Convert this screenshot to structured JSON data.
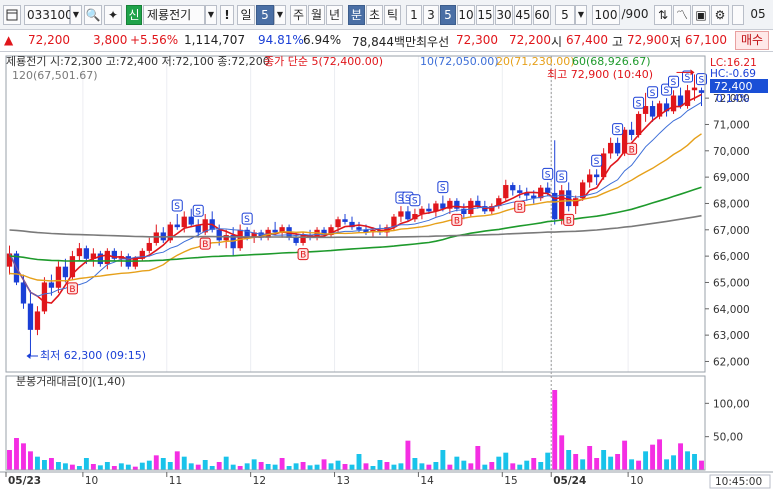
{
  "toolbar": {
    "code": "033100",
    "badge": "신",
    "name": "제룡전기",
    "mark": "!",
    "period_kind": "일",
    "period_value": "5",
    "tabs": [
      "주",
      "월",
      "년",
      "분",
      "초",
      "틱"
    ],
    "minutes": [
      "1",
      "3",
      "5",
      "10",
      "15",
      "30",
      "45",
      "60"
    ],
    "interval": "5",
    "count": "100",
    "count_total": "/900",
    "right_date": "05"
  },
  "quote": {
    "price": "72,200",
    "change": "3,800",
    "change_pct": "+5.56%",
    "volume": "1,114,707",
    "ratio1": "94.81%",
    "ratio2": "6.94%",
    "trade_value": "78,844백만",
    "best_label": "최우선",
    "best_ask": "72,300",
    "best_bid": "72,200",
    "open_label": "시",
    "open": "67,400",
    "high_label": "고",
    "high": "72,900",
    "low_label": "저",
    "low": "67,100",
    "buy_button": "매수"
  },
  "colors": {
    "up": "#e0161b",
    "down": "#1a3fd6",
    "ma5": "#e0161b",
    "ma10": "#3e6fd8",
    "ma20": "#e6a01a",
    "ma60": "#1e9a2c",
    "ma120": "#7a7a7a",
    "volume_pink": "#f42ee3",
    "volume_cyan": "#19c3ea"
  },
  "chart_data": [
    {
      "type": "candlestick",
      "title": "제룡전기 시:72,300 고:72,400 저:72,100 종:72,200",
      "legend": {
        "ma5": "종가 단순 5(72,400.00)",
        "ma10": "10(72,050.00)",
        "ma20": "20(71,230.00)",
        "ma60": "60(68,926.67)",
        "ma120": "120(67,501.67)"
      },
      "ylim": [
        61600,
        73600
      ],
      "y_ticks": [
        62000,
        63000,
        64000,
        65000,
        66000,
        67000,
        68000,
        69000,
        70000,
        71000,
        72000
      ],
      "y_tick_labels": [
        "62,000",
        "63,000",
        "64,000",
        "65,000",
        "66,000",
        "67,000",
        "68,000",
        "69,000",
        "70,000",
        "71,000",
        "72,000"
      ],
      "x_ticks": [
        {
          "label": "05/23",
          "bar": 0
        },
        {
          "label": "10",
          "bar": 11
        },
        {
          "label": "11",
          "bar": 23
        },
        {
          "label": "12",
          "bar": 35
        },
        {
          "label": "13",
          "bar": 47
        },
        {
          "label": "14",
          "bar": 59
        },
        {
          "label": "15",
          "bar": 71
        },
        {
          "label": "05/24",
          "bar": 78
        },
        {
          "label": "10",
          "bar": 89
        }
      ],
      "time_box": "10:45:00",
      "session_divider_bar": 78,
      "price_box": "72,400",
      "price_box_pct": "0.14%",
      "lc": "LC:16.21",
      "hc": "HC:-0.69",
      "high_annotation": "최고 72,900 (10:40)",
      "high_value": 72900,
      "high_bar": 98,
      "low_annotation": "최저 62,300 (09:15)",
      "low_value": 62300,
      "low_bar": 3,
      "candles": [
        {
          "o": 65600,
          "h": 66400,
          "l": 65300,
          "c": 66100
        },
        {
          "o": 66100,
          "h": 66200,
          "l": 64900,
          "c": 65000
        },
        {
          "o": 65000,
          "h": 65300,
          "l": 64000,
          "c": 64200
        },
        {
          "o": 64200,
          "h": 64700,
          "l": 62300,
          "c": 63200
        },
        {
          "o": 63200,
          "h": 64100,
          "l": 63000,
          "c": 63900
        },
        {
          "o": 63900,
          "h": 65200,
          "l": 63800,
          "c": 65000
        },
        {
          "o": 65000,
          "h": 65300,
          "l": 64500,
          "c": 64800
        },
        {
          "o": 64800,
          "h": 65800,
          "l": 64600,
          "c": 65600
        },
        {
          "o": 65600,
          "h": 65900,
          "l": 65000,
          "c": 65200
        },
        {
          "o": 65200,
          "h": 66200,
          "l": 65100,
          "c": 66000
        },
        {
          "o": 66000,
          "h": 66500,
          "l": 65800,
          "c": 66300
        },
        {
          "o": 66300,
          "h": 66400,
          "l": 65700,
          "c": 65900
        },
        {
          "o": 65900,
          "h": 66300,
          "l": 65600,
          "c": 66100
        },
        {
          "o": 66100,
          "h": 66200,
          "l": 65600,
          "c": 65700
        },
        {
          "o": 65700,
          "h": 66300,
          "l": 65500,
          "c": 66200
        },
        {
          "o": 66200,
          "h": 66300,
          "l": 65800,
          "c": 65900
        },
        {
          "o": 65900,
          "h": 66200,
          "l": 65600,
          "c": 66000
        },
        {
          "o": 66000,
          "h": 66100,
          "l": 65500,
          "c": 65600
        },
        {
          "o": 65600,
          "h": 66000,
          "l": 65500,
          "c": 65900
        },
        {
          "o": 65900,
          "h": 66300,
          "l": 65800,
          "c": 66200
        },
        {
          "o": 66200,
          "h": 66700,
          "l": 66100,
          "c": 66500
        },
        {
          "o": 66500,
          "h": 67200,
          "l": 66400,
          "c": 66900
        },
        {
          "o": 66900,
          "h": 67100,
          "l": 66500,
          "c": 66600
        },
        {
          "o": 66600,
          "h": 67300,
          "l": 66500,
          "c": 67200
        },
        {
          "o": 67200,
          "h": 67600,
          "l": 67000,
          "c": 67100
        },
        {
          "o": 67100,
          "h": 67700,
          "l": 66900,
          "c": 67500
        },
        {
          "o": 67500,
          "h": 67800,
          "l": 67100,
          "c": 67200
        },
        {
          "o": 67200,
          "h": 67400,
          "l": 66700,
          "c": 66900
        },
        {
          "o": 66900,
          "h": 67600,
          "l": 66800,
          "c": 67400
        },
        {
          "o": 67400,
          "h": 67700,
          "l": 66900,
          "c": 67000
        },
        {
          "o": 67000,
          "h": 67200,
          "l": 66400,
          "c": 66600
        },
        {
          "o": 66600,
          "h": 67000,
          "l": 66300,
          "c": 66800
        },
        {
          "o": 66800,
          "h": 67100,
          "l": 66000,
          "c": 66300
        },
        {
          "o": 66300,
          "h": 67200,
          "l": 66200,
          "c": 67000
        },
        {
          "o": 67000,
          "h": 67100,
          "l": 66600,
          "c": 66700
        },
        {
          "o": 66700,
          "h": 67000,
          "l": 66500,
          "c": 66900
        },
        {
          "o": 66900,
          "h": 67000,
          "l": 66600,
          "c": 66700
        },
        {
          "o": 66700,
          "h": 67100,
          "l": 66600,
          "c": 67000
        },
        {
          "o": 67000,
          "h": 67300,
          "l": 66800,
          "c": 66900
        },
        {
          "o": 66900,
          "h": 67200,
          "l": 66700,
          "c": 67100
        },
        {
          "o": 67100,
          "h": 67200,
          "l": 66600,
          "c": 66700
        },
        {
          "o": 66700,
          "h": 66900,
          "l": 66400,
          "c": 66500
        },
        {
          "o": 66500,
          "h": 66900,
          "l": 66400,
          "c": 66800
        },
        {
          "o": 66800,
          "h": 67000,
          "l": 66600,
          "c": 66700
        },
        {
          "o": 66700,
          "h": 67100,
          "l": 66600,
          "c": 67000
        },
        {
          "o": 67000,
          "h": 67100,
          "l": 66700,
          "c": 66800
        },
        {
          "o": 66800,
          "h": 67200,
          "l": 66700,
          "c": 67100
        },
        {
          "o": 67100,
          "h": 67500,
          "l": 66900,
          "c": 67400
        },
        {
          "o": 67400,
          "h": 67600,
          "l": 67200,
          "c": 67300
        },
        {
          "o": 67300,
          "h": 67500,
          "l": 67000,
          "c": 67100
        },
        {
          "o": 67100,
          "h": 67300,
          "l": 66900,
          "c": 67000
        },
        {
          "o": 67000,
          "h": 67200,
          "l": 66800,
          "c": 66900
        },
        {
          "o": 66900,
          "h": 67100,
          "l": 66700,
          "c": 67000
        },
        {
          "o": 67000,
          "h": 67200,
          "l": 66800,
          "c": 66900
        },
        {
          "o": 66900,
          "h": 67200,
          "l": 66700,
          "c": 67100
        },
        {
          "o": 67100,
          "h": 67600,
          "l": 67000,
          "c": 67500
        },
        {
          "o": 67500,
          "h": 67900,
          "l": 67300,
          "c": 67700
        },
        {
          "o": 67700,
          "h": 67900,
          "l": 67300,
          "c": 67400
        },
        {
          "o": 67400,
          "h": 67800,
          "l": 67300,
          "c": 67600
        },
        {
          "o": 67600,
          "h": 67900,
          "l": 67400,
          "c": 67800
        },
        {
          "o": 67800,
          "h": 68000,
          "l": 67600,
          "c": 67700
        },
        {
          "o": 67700,
          "h": 68100,
          "l": 67500,
          "c": 68000
        },
        {
          "o": 68000,
          "h": 68300,
          "l": 67700,
          "c": 67800
        },
        {
          "o": 67800,
          "h": 68200,
          "l": 67600,
          "c": 68100
        },
        {
          "o": 68100,
          "h": 68200,
          "l": 67700,
          "c": 67800
        },
        {
          "o": 67800,
          "h": 68000,
          "l": 67400,
          "c": 67600
        },
        {
          "o": 67600,
          "h": 68200,
          "l": 67500,
          "c": 68100
        },
        {
          "o": 68100,
          "h": 68300,
          "l": 67800,
          "c": 67900
        },
        {
          "o": 67900,
          "h": 68100,
          "l": 67600,
          "c": 67700
        },
        {
          "o": 67700,
          "h": 68000,
          "l": 67600,
          "c": 67900
        },
        {
          "o": 67900,
          "h": 68300,
          "l": 67800,
          "c": 68200
        },
        {
          "o": 68200,
          "h": 68900,
          "l": 68100,
          "c": 68700
        },
        {
          "o": 68700,
          "h": 68800,
          "l": 68300,
          "c": 68500
        },
        {
          "o": 68500,
          "h": 68700,
          "l": 68200,
          "c": 68400
        },
        {
          "o": 68400,
          "h": 68600,
          "l": 68100,
          "c": 68300
        },
        {
          "o": 68300,
          "h": 68500,
          "l": 68000,
          "c": 68200
        },
        {
          "o": 68200,
          "h": 68700,
          "l": 68100,
          "c": 68600
        },
        {
          "o": 68600,
          "h": 68800,
          "l": 68300,
          "c": 68400
        },
        {
          "o": 68400,
          "h": 70400,
          "l": 67200,
          "c": 67400
        },
        {
          "o": 67400,
          "h": 68700,
          "l": 67200,
          "c": 68500
        },
        {
          "o": 68500,
          "h": 68800,
          "l": 67700,
          "c": 67900
        },
        {
          "o": 67900,
          "h": 68300,
          "l": 67600,
          "c": 68200
        },
        {
          "o": 68200,
          "h": 68900,
          "l": 68100,
          "c": 68800
        },
        {
          "o": 68800,
          "h": 69300,
          "l": 68600,
          "c": 69100
        },
        {
          "o": 69100,
          "h": 69300,
          "l": 68700,
          "c": 69000
        },
        {
          "o": 69000,
          "h": 70100,
          "l": 68900,
          "c": 69900
        },
        {
          "o": 69900,
          "h": 70500,
          "l": 69700,
          "c": 70300
        },
        {
          "o": 70300,
          "h": 70500,
          "l": 69800,
          "c": 69900
        },
        {
          "o": 69900,
          "h": 70900,
          "l": 69800,
          "c": 70800
        },
        {
          "o": 70800,
          "h": 71100,
          "l": 70400,
          "c": 70600
        },
        {
          "o": 70600,
          "h": 71500,
          "l": 70500,
          "c": 71400
        },
        {
          "o": 71400,
          "h": 72200,
          "l": 71100,
          "c": 71700
        },
        {
          "o": 71700,
          "h": 71900,
          "l": 71100,
          "c": 71300
        },
        {
          "o": 71300,
          "h": 71900,
          "l": 71200,
          "c": 71800
        },
        {
          "o": 71800,
          "h": 72000,
          "l": 71300,
          "c": 71500
        },
        {
          "o": 71500,
          "h": 72300,
          "l": 71400,
          "c": 72100
        },
        {
          "o": 72100,
          "h": 72400,
          "l": 71600,
          "c": 71700
        },
        {
          "o": 71700,
          "h": 72500,
          "l": 71600,
          "c": 72300
        },
        {
          "o": 72300,
          "h": 72900,
          "l": 71900,
          "c": 72400
        },
        {
          "o": 72300,
          "h": 72400,
          "l": 71700,
          "c": 72200
        }
      ],
      "buy_signals": [
        9,
        28,
        42,
        64,
        73,
        80,
        89
      ],
      "sell_signals": [
        24,
        27,
        34,
        56,
        57,
        58,
        62,
        77,
        79,
        84,
        87,
        90,
        92,
        94,
        95,
        97,
        99
      ]
    },
    {
      "type": "bar",
      "title": "분봉거래대금[0](1,40)",
      "ylim": [
        0,
        120
      ],
      "y_ticks": [
        50,
        100
      ],
      "y_tick_labels": [
        "50,00",
        "100,00"
      ],
      "values": [
        30,
        48,
        40,
        28,
        20,
        15,
        18,
        12,
        10,
        8,
        6,
        18,
        9,
        7,
        12,
        6,
        10,
        8,
        5,
        11,
        14,
        22,
        18,
        12,
        28,
        20,
        10,
        8,
        15,
        6,
        12,
        20,
        8,
        6,
        10,
        16,
        12,
        9,
        8,
        18,
        6,
        10,
        12,
        7,
        8,
        16,
        10,
        14,
        9,
        8,
        24,
        10,
        6,
        15,
        12,
        8,
        10,
        44,
        18,
        10,
        8,
        12,
        30,
        8,
        20,
        14,
        10,
        36,
        8,
        12,
        20,
        26,
        10,
        8,
        14,
        18,
        12,
        26,
        120,
        52,
        30,
        24,
        16,
        36,
        18,
        30,
        20,
        24,
        44,
        16,
        14,
        28,
        38,
        46,
        16,
        22,
        40,
        28,
        24,
        14
      ]
    }
  ]
}
